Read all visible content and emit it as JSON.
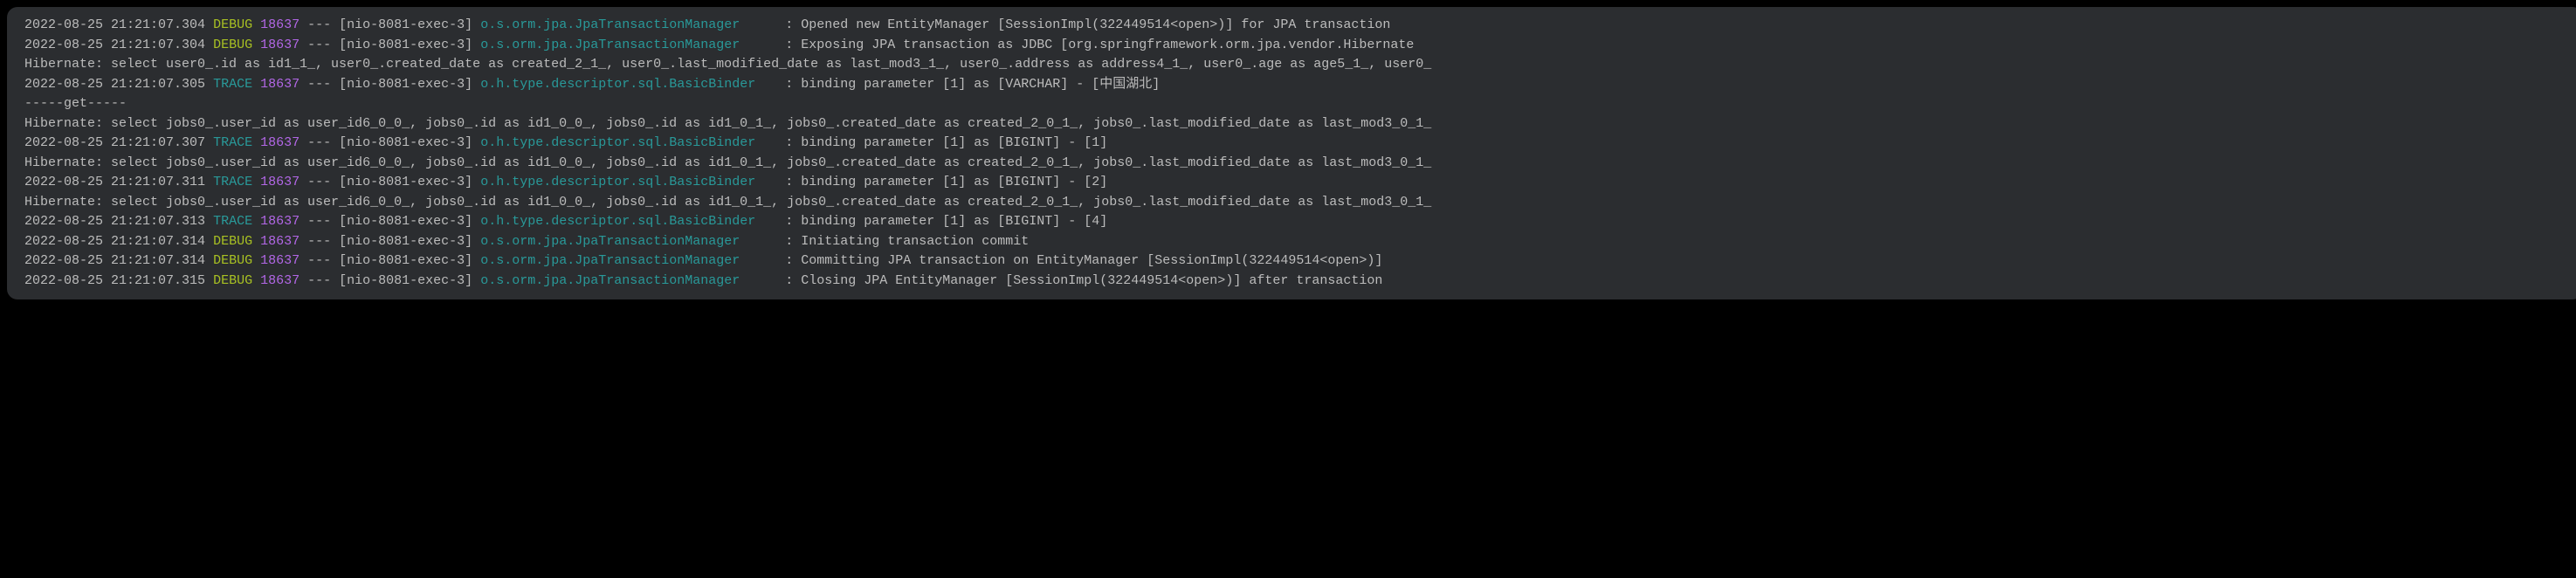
{
  "lines": [
    {
      "type": "log",
      "timestamp": "2022-08-25 21:21:07.304",
      "level": "DEBUG",
      "pid": "18637",
      "sep": "---",
      "thread": "[nio-8081-exec-3]",
      "logger": "o.s.orm.jpa.JpaTransactionManager",
      "message": "Opened new EntityManager [SessionImpl(322449514<open>)] for JPA transaction"
    },
    {
      "type": "log",
      "timestamp": "2022-08-25 21:21:07.304",
      "level": "DEBUG",
      "pid": "18637",
      "sep": "---",
      "thread": "[nio-8081-exec-3]",
      "logger": "o.s.orm.jpa.JpaTransactionManager",
      "message": "Exposing JPA transaction as JDBC [org.springframework.orm.jpa.vendor.Hibernate"
    },
    {
      "type": "plain",
      "text": "Hibernate: select user0_.id as id1_1_, user0_.created_date as created_2_1_, user0_.last_modified_date as last_mod3_1_, user0_.address as address4_1_, user0_.age as age5_1_, user0_"
    },
    {
      "type": "log",
      "timestamp": "2022-08-25 21:21:07.305",
      "level": "TRACE",
      "pid": "18637",
      "sep": "---",
      "thread": "[nio-8081-exec-3]",
      "logger": "o.h.type.descriptor.sql.BasicBinder",
      "message": "binding parameter [1] as [VARCHAR] - [中国湖北]"
    },
    {
      "type": "plain",
      "text": "-----get-----"
    },
    {
      "type": "plain",
      "text": "Hibernate: select jobs0_.user_id as user_id6_0_0_, jobs0_.id as id1_0_0_, jobs0_.id as id1_0_1_, jobs0_.created_date as created_2_0_1_, jobs0_.last_modified_date as last_mod3_0_1_"
    },
    {
      "type": "log",
      "timestamp": "2022-08-25 21:21:07.307",
      "level": "TRACE",
      "pid": "18637",
      "sep": "---",
      "thread": "[nio-8081-exec-3]",
      "logger": "o.h.type.descriptor.sql.BasicBinder",
      "message": "binding parameter [1] as [BIGINT] - [1]"
    },
    {
      "type": "plain",
      "text": "Hibernate: select jobs0_.user_id as user_id6_0_0_, jobs0_.id as id1_0_0_, jobs0_.id as id1_0_1_, jobs0_.created_date as created_2_0_1_, jobs0_.last_modified_date as last_mod3_0_1_"
    },
    {
      "type": "log",
      "timestamp": "2022-08-25 21:21:07.311",
      "level": "TRACE",
      "pid": "18637",
      "sep": "---",
      "thread": "[nio-8081-exec-3]",
      "logger": "o.h.type.descriptor.sql.BasicBinder",
      "message": "binding parameter [1] as [BIGINT] - [2]"
    },
    {
      "type": "plain",
      "text": "Hibernate: select jobs0_.user_id as user_id6_0_0_, jobs0_.id as id1_0_0_, jobs0_.id as id1_0_1_, jobs0_.created_date as created_2_0_1_, jobs0_.last_modified_date as last_mod3_0_1_"
    },
    {
      "type": "log",
      "timestamp": "2022-08-25 21:21:07.313",
      "level": "TRACE",
      "pid": "18637",
      "sep": "---",
      "thread": "[nio-8081-exec-3]",
      "logger": "o.h.type.descriptor.sql.BasicBinder",
      "message": "binding parameter [1] as [BIGINT] - [4]"
    },
    {
      "type": "log",
      "timestamp": "2022-08-25 21:21:07.314",
      "level": "DEBUG",
      "pid": "18637",
      "sep": "---",
      "thread": "[nio-8081-exec-3]",
      "logger": "o.s.orm.jpa.JpaTransactionManager",
      "message": "Initiating transaction commit"
    },
    {
      "type": "log",
      "timestamp": "2022-08-25 21:21:07.314",
      "level": "DEBUG",
      "pid": "18637",
      "sep": "---",
      "thread": "[nio-8081-exec-3]",
      "logger": "o.s.orm.jpa.JpaTransactionManager",
      "message": "Committing JPA transaction on EntityManager [SessionImpl(322449514<open>)]"
    },
    {
      "type": "log",
      "timestamp": "2022-08-25 21:21:07.315",
      "level": "DEBUG",
      "pid": "18637",
      "sep": "---",
      "thread": "[nio-8081-exec-3]",
      "logger": "o.s.orm.jpa.JpaTransactionManager",
      "message": "Closing JPA EntityManager [SessionImpl(322449514<open>)] after transaction"
    }
  ]
}
